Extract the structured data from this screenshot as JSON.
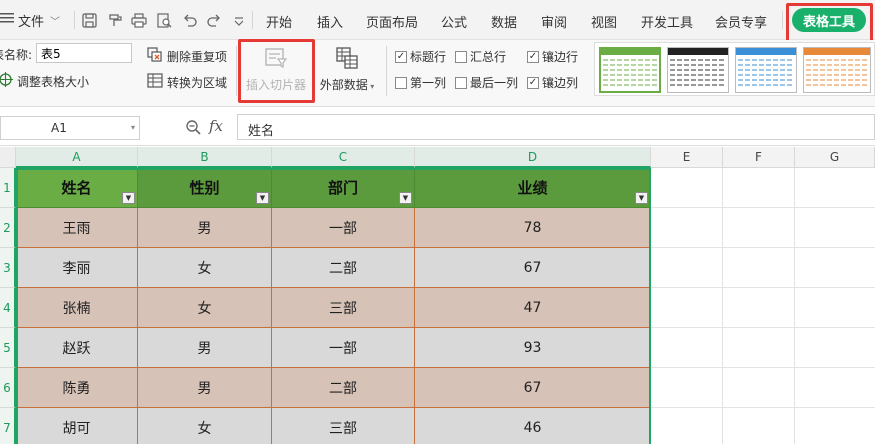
{
  "menubar": {
    "file_label": "文件",
    "tabs": [
      "开始",
      "插入",
      "页面布局",
      "公式",
      "数据",
      "审阅",
      "视图",
      "开发工具",
      "会员专享"
    ],
    "active_tab": "表格工具"
  },
  "ribbon": {
    "table_name_label": "表名称:",
    "table_name_value": "表5",
    "resize_table": "调整表格大小",
    "remove_duplicates": "删除重复项",
    "convert_to_range": "转换为区域",
    "insert_slicer": "插入切片器",
    "external_data": "外部数据",
    "checkboxes": [
      {
        "label": "标题行",
        "checked": true
      },
      {
        "label": "汇总行",
        "checked": false
      },
      {
        "label": "镶边行",
        "checked": true
      },
      {
        "label": "第一列",
        "checked": false
      },
      {
        "label": "最后一列",
        "checked": false
      },
      {
        "label": "镶边列",
        "checked": true
      }
    ]
  },
  "formula_bar": {
    "cell_ref": "A1",
    "fx": "fx",
    "content": "姓名"
  },
  "grid": {
    "columns": [
      "A",
      "B",
      "C",
      "D",
      "E",
      "F",
      "G"
    ],
    "rows": [
      "1",
      "2",
      "3",
      "4",
      "5",
      "6",
      "7"
    ],
    "table": {
      "headers": [
        "姓名",
        "性别",
        "部门",
        "业绩"
      ],
      "rows": [
        [
          "王雨",
          "男",
          "一部",
          "78"
        ],
        [
          "李丽",
          "女",
          "二部",
          "67"
        ],
        [
          "张楠",
          "女",
          "三部",
          "47"
        ],
        [
          "赵跃",
          "男",
          "一部",
          "93"
        ],
        [
          "陈勇",
          "男",
          "二部",
          "67"
        ],
        [
          "胡可",
          "女",
          "三部",
          "46"
        ]
      ]
    }
  },
  "colors": {
    "accent": "#19b06c",
    "header_fill": "#5b9a3d",
    "band_a": "#d6c2b6",
    "band_b": "#d9d9d9",
    "highlight": "#e53935"
  }
}
